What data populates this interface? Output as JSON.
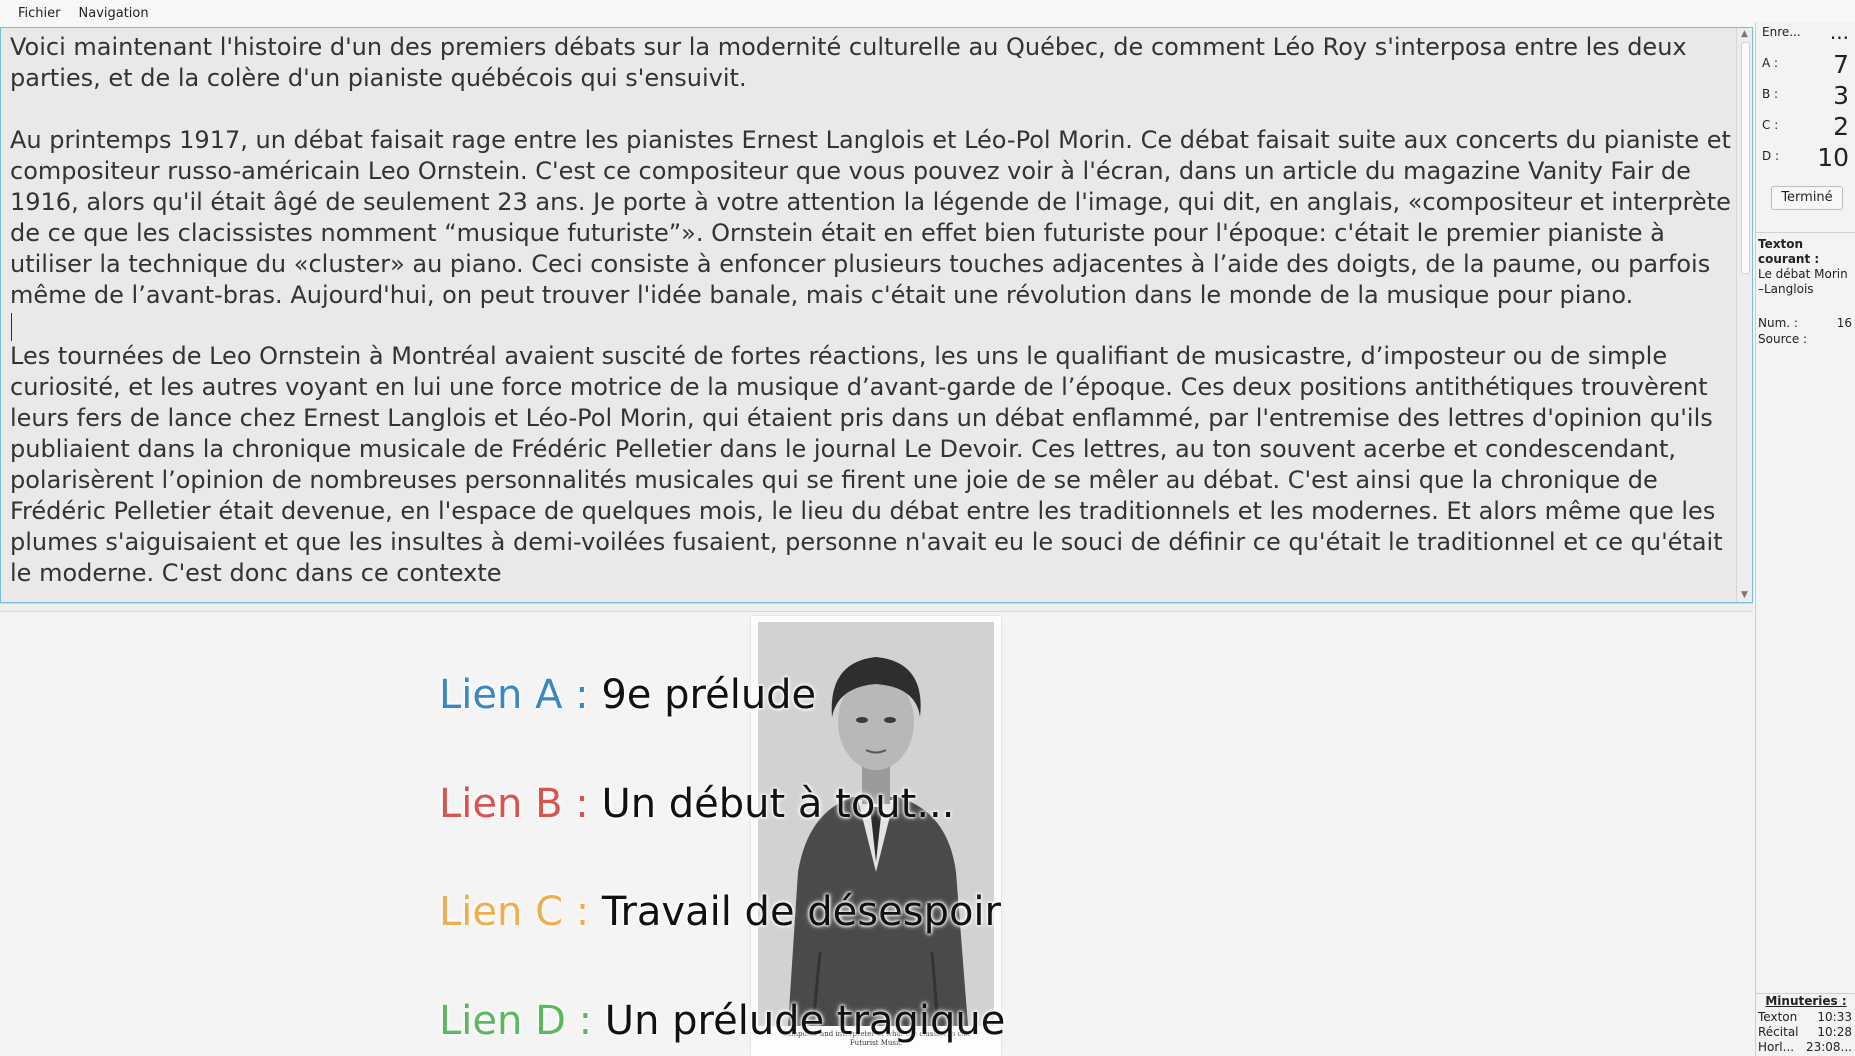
{
  "menubar": {
    "file": "Fichier",
    "navigation": "Navigation"
  },
  "editor": {
    "paragraph1": "Voici maintenant l'histoire d'un des premiers débats sur la modernité culturelle au Québec, de comment Léo Roy s'interposa entre les deux parties, et de la colère d'un pianiste québécois qui s'ensuivit.",
    "paragraph2": "Au printemps 1917, un débat faisait rage entre les pianistes Ernest Langlois et Léo-Pol Morin. Ce débat faisait suite aux concerts du pianiste et compositeur russo-américain Leo Ornstein. C'est ce compositeur que vous pouvez voir à l'écran, dans un article du magazine Vanity Fair de 1916, alors qu'il était âgé de seulement 23 ans. Je porte à votre attention la légende de l'image, qui dit, en anglais, «compositeur et interprète de ce que les clacissistes nomment “musique futuriste”». Ornstein était en effet bien futuriste pour l'époque: c'était le premier pianiste à utiliser la technique du «cluster» au piano. Ceci consiste à enfoncer plusieurs touches adjacentes à l’aide des doigts, de la paume, ou parfois même de l’avant-bras. Aujourd'hui, on peut trouver l'idée banale, mais c'était une révolution dans le monde de la musique pour piano.",
    "paragraph3": "Les tournées de Leo Ornstein à Montréal avaient suscité de fortes réactions, les uns le qualifiant de musicastre, d’imposteur ou de simple curiosité, et les autres voyant en lui une force motrice de la musique d’avant-garde de l’époque. Ces deux positions antithétiques trouvèrent leurs fers de lance chez Ernest Langlois et Léo-Pol Morin, qui étaient pris dans un débat enflammé, par l'entremise des lettres d'opinion qu'ils publiaient dans la chronique musicale de Frédéric Pelletier dans le journal Le Devoir. Ces lettres, au ton souvent acerbe et condescendant, polarisèrent l’opinion de nombreuses personnalités musicales qui se firent une joie de se mêler au débat. C'est ainsi que la chronique de Frédéric Pelletier était devenue, en l'espace de quelques mois, le lieu du débat entre les traditionnels et les modernes. Et alors même que les plumes s'aiguisaient et que les insultes à demi-voilées fusaient, personne n'avait eu le souci de définir ce qu'était le traditionnel et ce qu'était le moderne. C'est donc dans ce contexte"
  },
  "links": [
    {
      "key": "Lien A :",
      "text": "9e prélude",
      "color": "#3a87c6"
    },
    {
      "key": "Lien B :",
      "text": "Un début à tout...",
      "color": "#d9534f"
    },
    {
      "key": "Lien C :",
      "text": "Travail de désespoir",
      "color": "#f0ad4e"
    },
    {
      "key": "Lien D :",
      "text": "Un prélude tragique",
      "color": "#5cb85c"
    }
  ],
  "photo": {
    "caption_line1": "Composer and interpreter of what the classicists call",
    "caption_line2": "Futurist Music"
  },
  "sidebar": {
    "recording_label": "Enre...",
    "recording_value": "...",
    "counts": [
      {
        "label": "A :",
        "value": "7"
      },
      {
        "label": "B :",
        "value": "3"
      },
      {
        "label": "C :",
        "value": "2"
      },
      {
        "label": "D :",
        "value": "10"
      }
    ],
    "done_button": "Terminé",
    "current_label": "Texton courant :",
    "current_title": "Le débat Morin–Langlois",
    "num_label": "Num. :",
    "num_value": "16",
    "source_label": "Source :",
    "timers_label": "Minuteries :",
    "timers": [
      {
        "label": "Texton",
        "value": "10:33"
      },
      {
        "label": "Récital",
        "value": "10:28"
      },
      {
        "label": "Horl...",
        "value": "23:08..."
      }
    ]
  }
}
